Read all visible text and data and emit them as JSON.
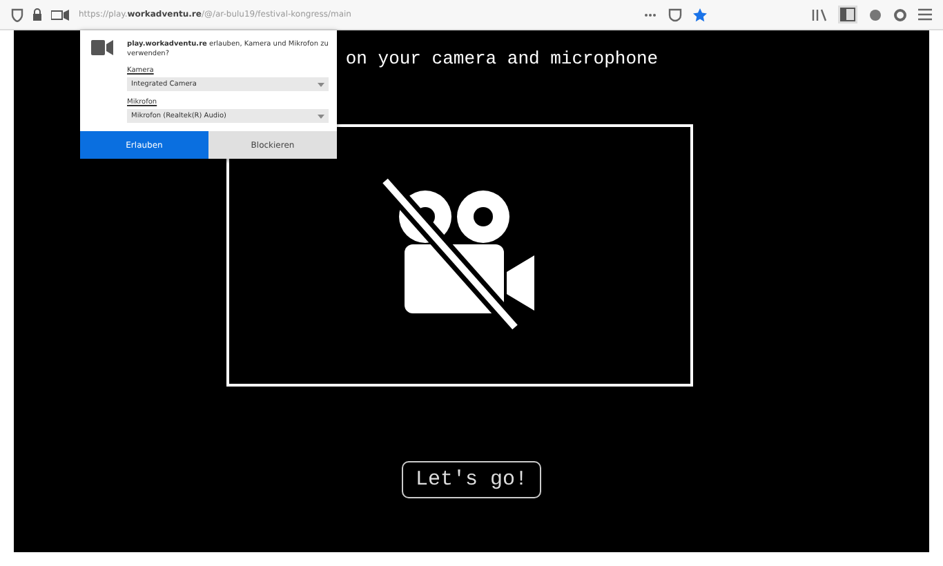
{
  "browser": {
    "url": "https://play.**workadventu.re**/@/ar-bulu19/festival-kongress/main"
  },
  "permission_popup": {
    "message": "**play.workadventu.re** erlauben, Kamera und Mikrofon zu verwenden?",
    "camera_label": "Kamera",
    "camera_value": "Integrated Camera",
    "microphone_label": "Mikrofon",
    "microphone_value": "Mikrofon (Realtek(R) Audio)",
    "buttons": [
      {
        "label": "Erlauben",
        "kind": "primary"
      },
      {
        "label": "Blockieren",
        "kind": "secondary"
      }
    ]
  },
  "page": {
    "heading": "on your camera and microphone",
    "camera_enabled": false,
    "button": "Let's go!"
  }
}
